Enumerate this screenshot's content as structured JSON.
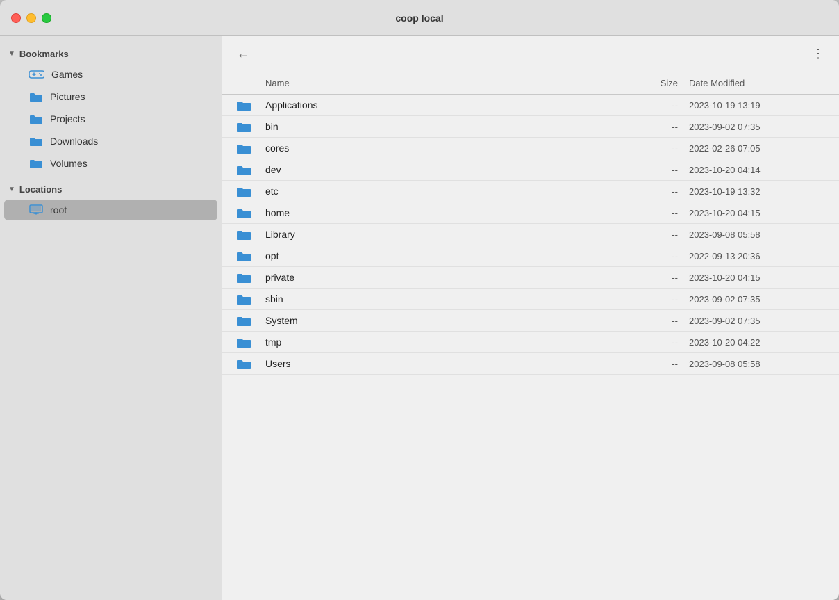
{
  "window": {
    "title": "coop local"
  },
  "sidebar": {
    "bookmarks_label": "Bookmarks",
    "locations_label": "Locations",
    "bookmark_items": [
      {
        "id": "games",
        "label": "Games",
        "icon": "games-icon"
      },
      {
        "id": "pictures",
        "label": "Pictures",
        "icon": "folder-icon"
      },
      {
        "id": "projects",
        "label": "Projects",
        "icon": "folder-icon"
      },
      {
        "id": "downloads",
        "label": "Downloads",
        "icon": "folder-icon"
      },
      {
        "id": "volumes",
        "label": "Volumes",
        "icon": "folder-icon"
      }
    ],
    "location_items": [
      {
        "id": "root",
        "label": "root",
        "icon": "computer-icon",
        "active": true
      }
    ]
  },
  "toolbar": {
    "back_label": "←",
    "more_label": "⋮"
  },
  "columns": {
    "name": "Name",
    "size": "Size",
    "date_modified": "Date Modified"
  },
  "files": [
    {
      "name": "Applications",
      "size": "--",
      "date": "2023-10-19 13:19"
    },
    {
      "name": "bin",
      "size": "--",
      "date": "2023-09-02 07:35"
    },
    {
      "name": "cores",
      "size": "--",
      "date": "2022-02-26 07:05"
    },
    {
      "name": "dev",
      "size": "--",
      "date": "2023-10-20 04:14"
    },
    {
      "name": "etc",
      "size": "--",
      "date": "2023-10-19 13:32"
    },
    {
      "name": "home",
      "size": "--",
      "date": "2023-10-20 04:15"
    },
    {
      "name": "Library",
      "size": "--",
      "date": "2023-09-08 05:58"
    },
    {
      "name": "opt",
      "size": "--",
      "date": "2022-09-13 20:36"
    },
    {
      "name": "private",
      "size": "--",
      "date": "2023-10-20 04:15"
    },
    {
      "name": "sbin",
      "size": "--",
      "date": "2023-09-02 07:35"
    },
    {
      "name": "System",
      "size": "--",
      "date": "2023-09-02 07:35"
    },
    {
      "name": "tmp",
      "size": "--",
      "date": "2023-10-20 04:22"
    },
    {
      "name": "Users",
      "size": "--",
      "date": "2023-09-08 05:58"
    }
  ],
  "colors": {
    "accent_blue": "#3a8fd4",
    "traffic_close": "#ff5f57",
    "traffic_min": "#ffbd2e",
    "traffic_max": "#28c940"
  }
}
